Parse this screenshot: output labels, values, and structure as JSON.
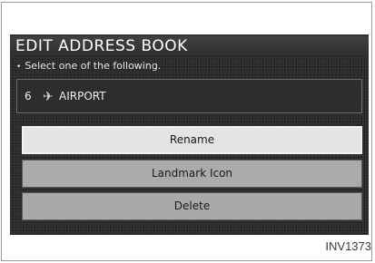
{
  "screen": {
    "title": "EDIT ADDRESS BOOK",
    "instruction": "Select one of the following.",
    "entry": {
      "number": "6",
      "icon": "airplane-icon",
      "name": "AIRPORT"
    },
    "options": {
      "rename": "Rename",
      "landmark_icon": "Landmark Icon",
      "delete": "Delete"
    }
  },
  "figure_code": "INV1373",
  "colors": {
    "screen_bg": "#2a2a2a",
    "selected_option": "#e4e4e4",
    "option": "#ababab"
  }
}
